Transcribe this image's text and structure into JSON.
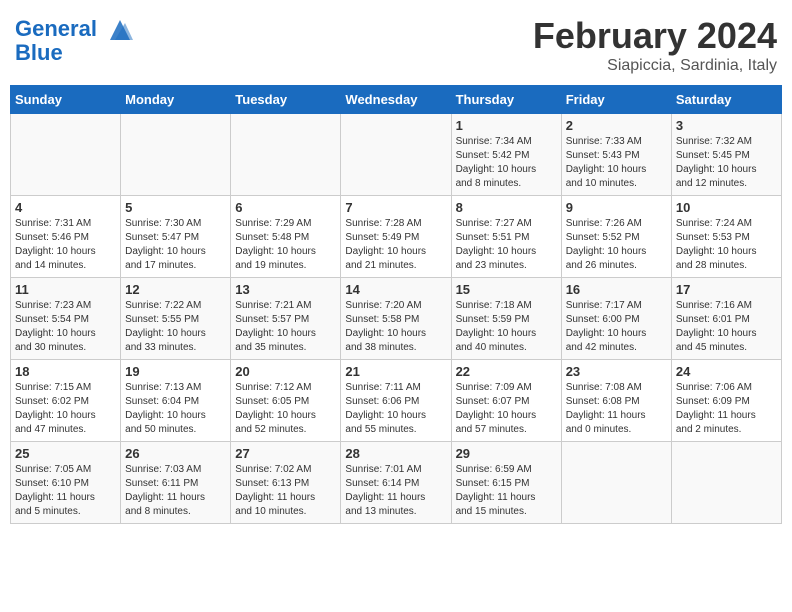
{
  "header": {
    "logo_line1": "General",
    "logo_line2": "Blue",
    "title": "February 2024",
    "subtitle": "Siapiccia, Sardinia, Italy"
  },
  "weekdays": [
    "Sunday",
    "Monday",
    "Tuesday",
    "Wednesday",
    "Thursday",
    "Friday",
    "Saturday"
  ],
  "weeks": [
    [
      {
        "day": "",
        "info": ""
      },
      {
        "day": "",
        "info": ""
      },
      {
        "day": "",
        "info": ""
      },
      {
        "day": "",
        "info": ""
      },
      {
        "day": "1",
        "info": "Sunrise: 7:34 AM\nSunset: 5:42 PM\nDaylight: 10 hours\nand 8 minutes."
      },
      {
        "day": "2",
        "info": "Sunrise: 7:33 AM\nSunset: 5:43 PM\nDaylight: 10 hours\nand 10 minutes."
      },
      {
        "day": "3",
        "info": "Sunrise: 7:32 AM\nSunset: 5:45 PM\nDaylight: 10 hours\nand 12 minutes."
      }
    ],
    [
      {
        "day": "4",
        "info": "Sunrise: 7:31 AM\nSunset: 5:46 PM\nDaylight: 10 hours\nand 14 minutes."
      },
      {
        "day": "5",
        "info": "Sunrise: 7:30 AM\nSunset: 5:47 PM\nDaylight: 10 hours\nand 17 minutes."
      },
      {
        "day": "6",
        "info": "Sunrise: 7:29 AM\nSunset: 5:48 PM\nDaylight: 10 hours\nand 19 minutes."
      },
      {
        "day": "7",
        "info": "Sunrise: 7:28 AM\nSunset: 5:49 PM\nDaylight: 10 hours\nand 21 minutes."
      },
      {
        "day": "8",
        "info": "Sunrise: 7:27 AM\nSunset: 5:51 PM\nDaylight: 10 hours\nand 23 minutes."
      },
      {
        "day": "9",
        "info": "Sunrise: 7:26 AM\nSunset: 5:52 PM\nDaylight: 10 hours\nand 26 minutes."
      },
      {
        "day": "10",
        "info": "Sunrise: 7:24 AM\nSunset: 5:53 PM\nDaylight: 10 hours\nand 28 minutes."
      }
    ],
    [
      {
        "day": "11",
        "info": "Sunrise: 7:23 AM\nSunset: 5:54 PM\nDaylight: 10 hours\nand 30 minutes."
      },
      {
        "day": "12",
        "info": "Sunrise: 7:22 AM\nSunset: 5:55 PM\nDaylight: 10 hours\nand 33 minutes."
      },
      {
        "day": "13",
        "info": "Sunrise: 7:21 AM\nSunset: 5:57 PM\nDaylight: 10 hours\nand 35 minutes."
      },
      {
        "day": "14",
        "info": "Sunrise: 7:20 AM\nSunset: 5:58 PM\nDaylight: 10 hours\nand 38 minutes."
      },
      {
        "day": "15",
        "info": "Sunrise: 7:18 AM\nSunset: 5:59 PM\nDaylight: 10 hours\nand 40 minutes."
      },
      {
        "day": "16",
        "info": "Sunrise: 7:17 AM\nSunset: 6:00 PM\nDaylight: 10 hours\nand 42 minutes."
      },
      {
        "day": "17",
        "info": "Sunrise: 7:16 AM\nSunset: 6:01 PM\nDaylight: 10 hours\nand 45 minutes."
      }
    ],
    [
      {
        "day": "18",
        "info": "Sunrise: 7:15 AM\nSunset: 6:02 PM\nDaylight: 10 hours\nand 47 minutes."
      },
      {
        "day": "19",
        "info": "Sunrise: 7:13 AM\nSunset: 6:04 PM\nDaylight: 10 hours\nand 50 minutes."
      },
      {
        "day": "20",
        "info": "Sunrise: 7:12 AM\nSunset: 6:05 PM\nDaylight: 10 hours\nand 52 minutes."
      },
      {
        "day": "21",
        "info": "Sunrise: 7:11 AM\nSunset: 6:06 PM\nDaylight: 10 hours\nand 55 minutes."
      },
      {
        "day": "22",
        "info": "Sunrise: 7:09 AM\nSunset: 6:07 PM\nDaylight: 10 hours\nand 57 minutes."
      },
      {
        "day": "23",
        "info": "Sunrise: 7:08 AM\nSunset: 6:08 PM\nDaylight: 11 hours\nand 0 minutes."
      },
      {
        "day": "24",
        "info": "Sunrise: 7:06 AM\nSunset: 6:09 PM\nDaylight: 11 hours\nand 2 minutes."
      }
    ],
    [
      {
        "day": "25",
        "info": "Sunrise: 7:05 AM\nSunset: 6:10 PM\nDaylight: 11 hours\nand 5 minutes."
      },
      {
        "day": "26",
        "info": "Sunrise: 7:03 AM\nSunset: 6:11 PM\nDaylight: 11 hours\nand 8 minutes."
      },
      {
        "day": "27",
        "info": "Sunrise: 7:02 AM\nSunset: 6:13 PM\nDaylight: 11 hours\nand 10 minutes."
      },
      {
        "day": "28",
        "info": "Sunrise: 7:01 AM\nSunset: 6:14 PM\nDaylight: 11 hours\nand 13 minutes."
      },
      {
        "day": "29",
        "info": "Sunrise: 6:59 AM\nSunset: 6:15 PM\nDaylight: 11 hours\nand 15 minutes."
      },
      {
        "day": "",
        "info": ""
      },
      {
        "day": "",
        "info": ""
      }
    ]
  ]
}
